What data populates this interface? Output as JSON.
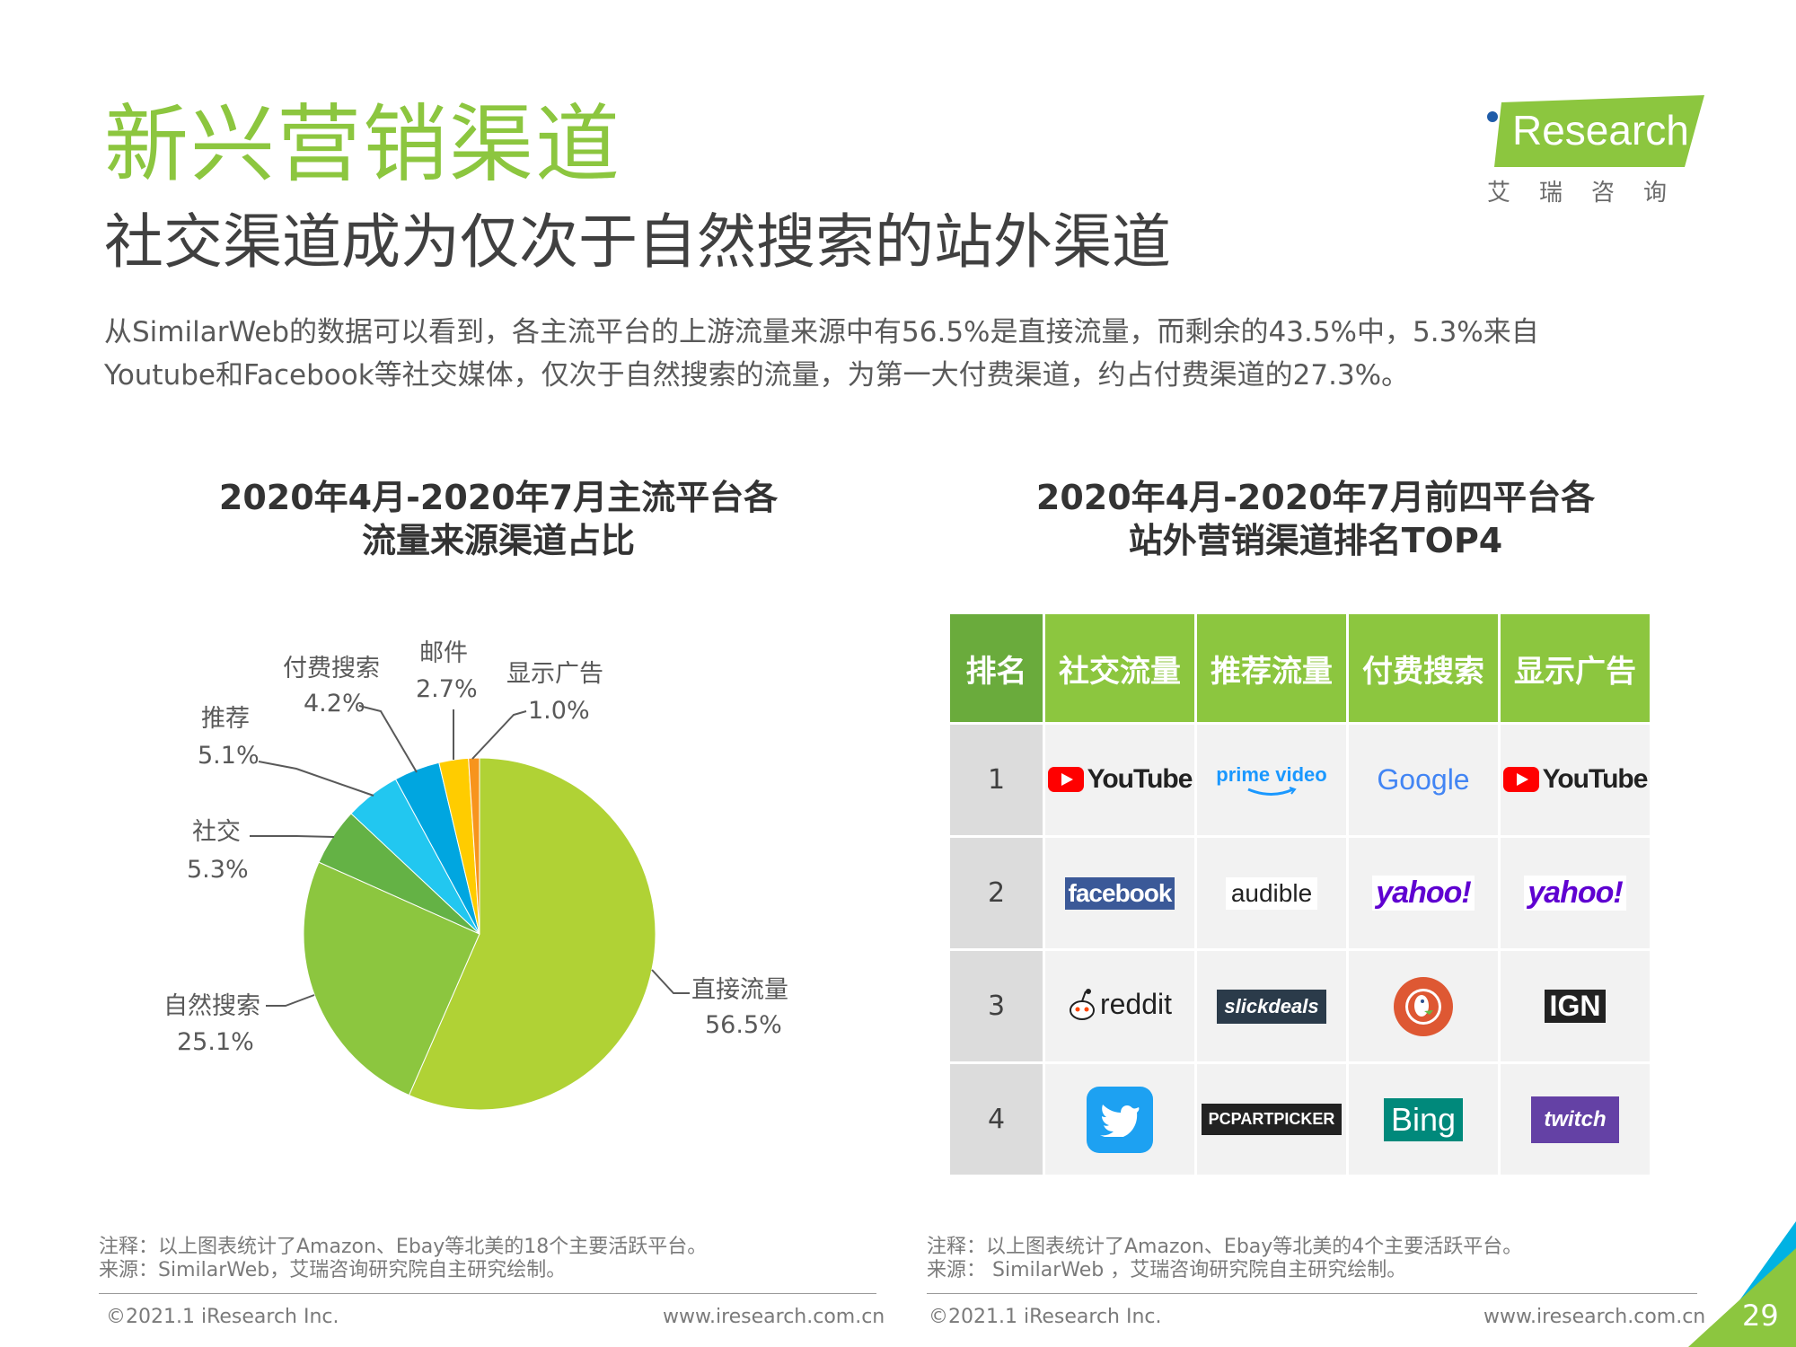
{
  "header": {
    "title": "新兴营销渠道",
    "subtitle": "社交渠道成为仅次于自然搜索的站外渠道",
    "description_lines": [
      "从SimilarWeb的数据可以看到，各主流平台的上游流量来源中有56.5%是直接流量，而剩余的43.5%中，5.3%来自",
      "Youtube和Facebook等社交媒体，仅次于自然搜索的流量，为第一大付费渠道，约占付费渠道的27.3%。"
    ]
  },
  "logo": {
    "word": "Research",
    "cn": "艾瑞咨询",
    "brand_color": "#8cc63f"
  },
  "left_chart": {
    "title_lines": [
      "2020年4月-2020年7月主流平台各",
      "流量来源渠道占比"
    ],
    "slices": [
      {
        "label": "直接流量",
        "pct_text": "56.5%"
      },
      {
        "label": "自然搜索",
        "pct_text": "25.1%"
      },
      {
        "label": "社交",
        "pct_text": "5.3%"
      },
      {
        "label": "推荐",
        "pct_text": "5.1%"
      },
      {
        "label": "付费搜索",
        "pct_text": "4.2%"
      },
      {
        "label": "邮件",
        "pct_text": "2.7%"
      },
      {
        "label": "显示广告",
        "pct_text": "1.0%"
      }
    ],
    "note": "注释：以上图表统计了Amazon、Ebay等北美的18个主要活跃平台。",
    "source": "来源：SimilarWeb，艾瑞咨询研究院自主研究绘制。"
  },
  "chart_data": {
    "type": "pie",
    "categories": [
      "直接流量",
      "自然搜索",
      "社交",
      "推荐",
      "付费搜索",
      "邮件",
      "显示广告"
    ],
    "values": [
      56.5,
      25.1,
      5.3,
      5.1,
      4.2,
      2.7,
      1.0
    ],
    "colors": [
      "#b0d235",
      "#8cc63f",
      "#64b245",
      "#22c7f0",
      "#00a6e0",
      "#ffcc00",
      "#f7941d"
    ],
    "title": "2020年4月-2020年7月主流平台各流量来源渠道占比"
  },
  "right_table": {
    "title_lines": [
      "2020年4月-2020年7月前四平台各",
      "站外营销渠道排名TOP4"
    ],
    "headers": [
      "排名",
      "社交流量",
      "推荐流量",
      "付费搜索",
      "显示广告"
    ],
    "rows": [
      {
        "rank": "1",
        "cells": [
          "YouTube",
          "prime video",
          "Google",
          "YouTube"
        ]
      },
      {
        "rank": "2",
        "cells": [
          "facebook",
          "audible",
          "yahoo!",
          "yahoo!"
        ]
      },
      {
        "rank": "3",
        "cells": [
          "reddit",
          "slickdeals",
          "",
          "IGN"
        ]
      },
      {
        "rank": "4",
        "cells": [
          "",
          "PCPARTPICKER",
          "Bing",
          "twitch"
        ]
      }
    ],
    "icons": {
      "duckduckgo": "duckduckgo-icon",
      "twitter": "twitter-bird-icon"
    },
    "note": "注释：以上图表统计了Amazon、Ebay等北美的4个主要活跃平台。",
    "source": "来源： SimilarWeb ，艾瑞咨询研究院自主研究绘制。"
  },
  "footer": {
    "copyright": "©2021.1 iResearch Inc.",
    "website": "www.iresearch.com.cn",
    "page_number": "29"
  }
}
